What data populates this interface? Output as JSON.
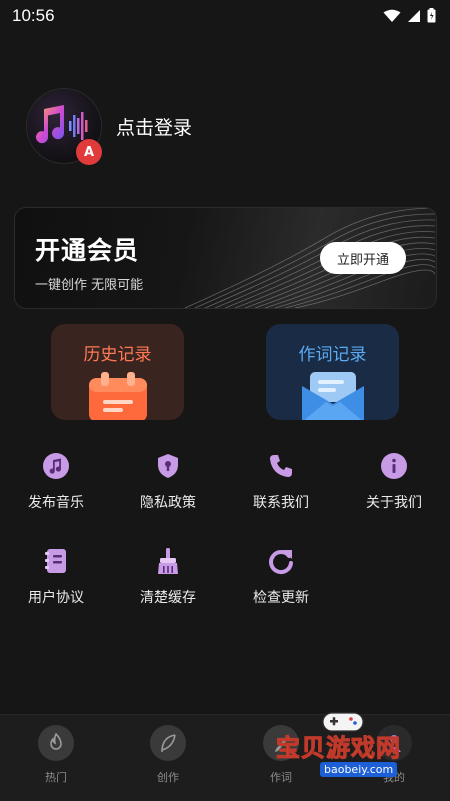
{
  "status_bar": {
    "time": "10:56"
  },
  "profile": {
    "login_text": "点击登录",
    "badge": "A"
  },
  "vip_card": {
    "title": "开通会员",
    "subtitle": "一键创作 无限可能",
    "button": "立即开通"
  },
  "records": [
    {
      "label": "历史记录",
      "color": "#ff7a55"
    },
    {
      "label": "作词记录",
      "color": "#5aa9f2"
    }
  ],
  "menu": [
    {
      "label": "发布音乐",
      "icon": "music-note-icon"
    },
    {
      "label": "隐私政策",
      "icon": "shield-lock-icon"
    },
    {
      "label": "联系我们",
      "icon": "phone-icon"
    },
    {
      "label": "关于我们",
      "icon": "info-icon"
    },
    {
      "label": "用户协议",
      "icon": "document-icon"
    },
    {
      "label": "清楚缓存",
      "icon": "broom-icon"
    },
    {
      "label": "检查更新",
      "icon": "refresh-icon"
    }
  ],
  "bottom_nav": [
    {
      "label": "热门",
      "icon": "fire-icon"
    },
    {
      "label": "创作",
      "icon": "feather-icon"
    },
    {
      "label": "作词",
      "icon": "pen-icon"
    },
    {
      "label": "我的",
      "icon": "user-icon"
    }
  ],
  "watermark": {
    "text": "宝贝游戏网",
    "url": "baobeiy.com"
  },
  "colors": {
    "accent_purple": "#b07ad6",
    "background": "#161616"
  }
}
